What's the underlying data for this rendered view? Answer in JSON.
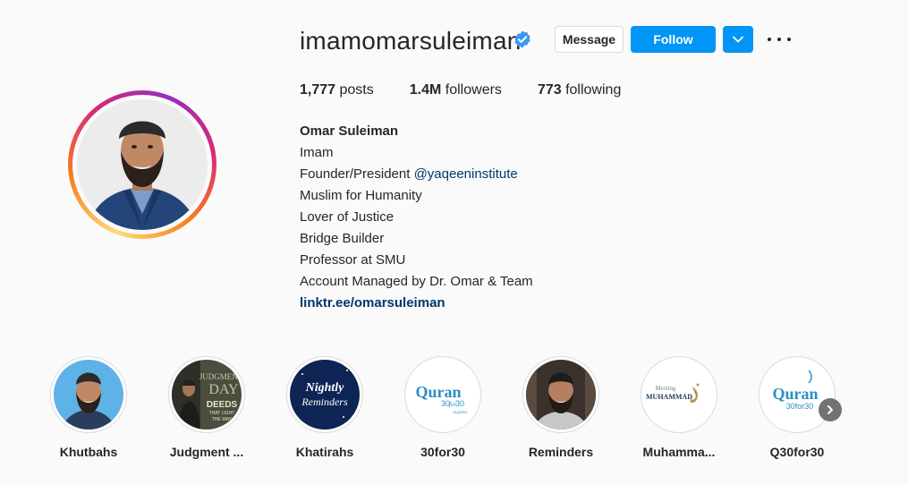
{
  "profile": {
    "username": "imamomarsuleiman",
    "verified": true,
    "message_label": "Message",
    "follow_label": "Follow",
    "accent_color": "#0095f6"
  },
  "stats": {
    "posts_count": "1,777",
    "posts_label": "posts",
    "followers_count": "1.4M",
    "followers_label": "followers",
    "following_count": "773",
    "following_label": "following"
  },
  "bio": {
    "name": "Omar Suleiman",
    "line1": "Imam",
    "line2_prefix": "Founder/President ",
    "line2_mention": "@yaqeeninstitute",
    "line3": "Muslim for Humanity",
    "line4": "Lover of Justice",
    "line5": "Bridge Builder",
    "line6": "Professor at SMU",
    "line7": "Account Managed by Dr. Omar & Team",
    "link": "linktr.ee/omarsuleiman"
  },
  "highlights": [
    {
      "label": "Khutbahs"
    },
    {
      "label": "Judgment ...",
      "image_text_1": "JUDGMENT",
      "image_text_2": "DAY",
      "image_text_3": "DEEDS",
      "image_text_4": "THAT LIGHT",
      "image_text_5": "THE WAY"
    },
    {
      "label": "Khatirahs",
      "image_text_1": "Nightly",
      "image_text_2": "Reminders"
    },
    {
      "label": "30for30",
      "image_text_1": "Quran",
      "image_text_2": "30",
      "image_text_3": "for",
      "image_text_4": "30",
      "image_text_5": "YAQEEN"
    },
    {
      "label": "Reminders"
    },
    {
      "label": "Muhamma...",
      "image_text_1": "Meeting",
      "image_text_2": "MUHAMMAD"
    },
    {
      "label": "Q30for30",
      "image_text_1": "Quran",
      "image_text_2": "30for30"
    }
  ]
}
